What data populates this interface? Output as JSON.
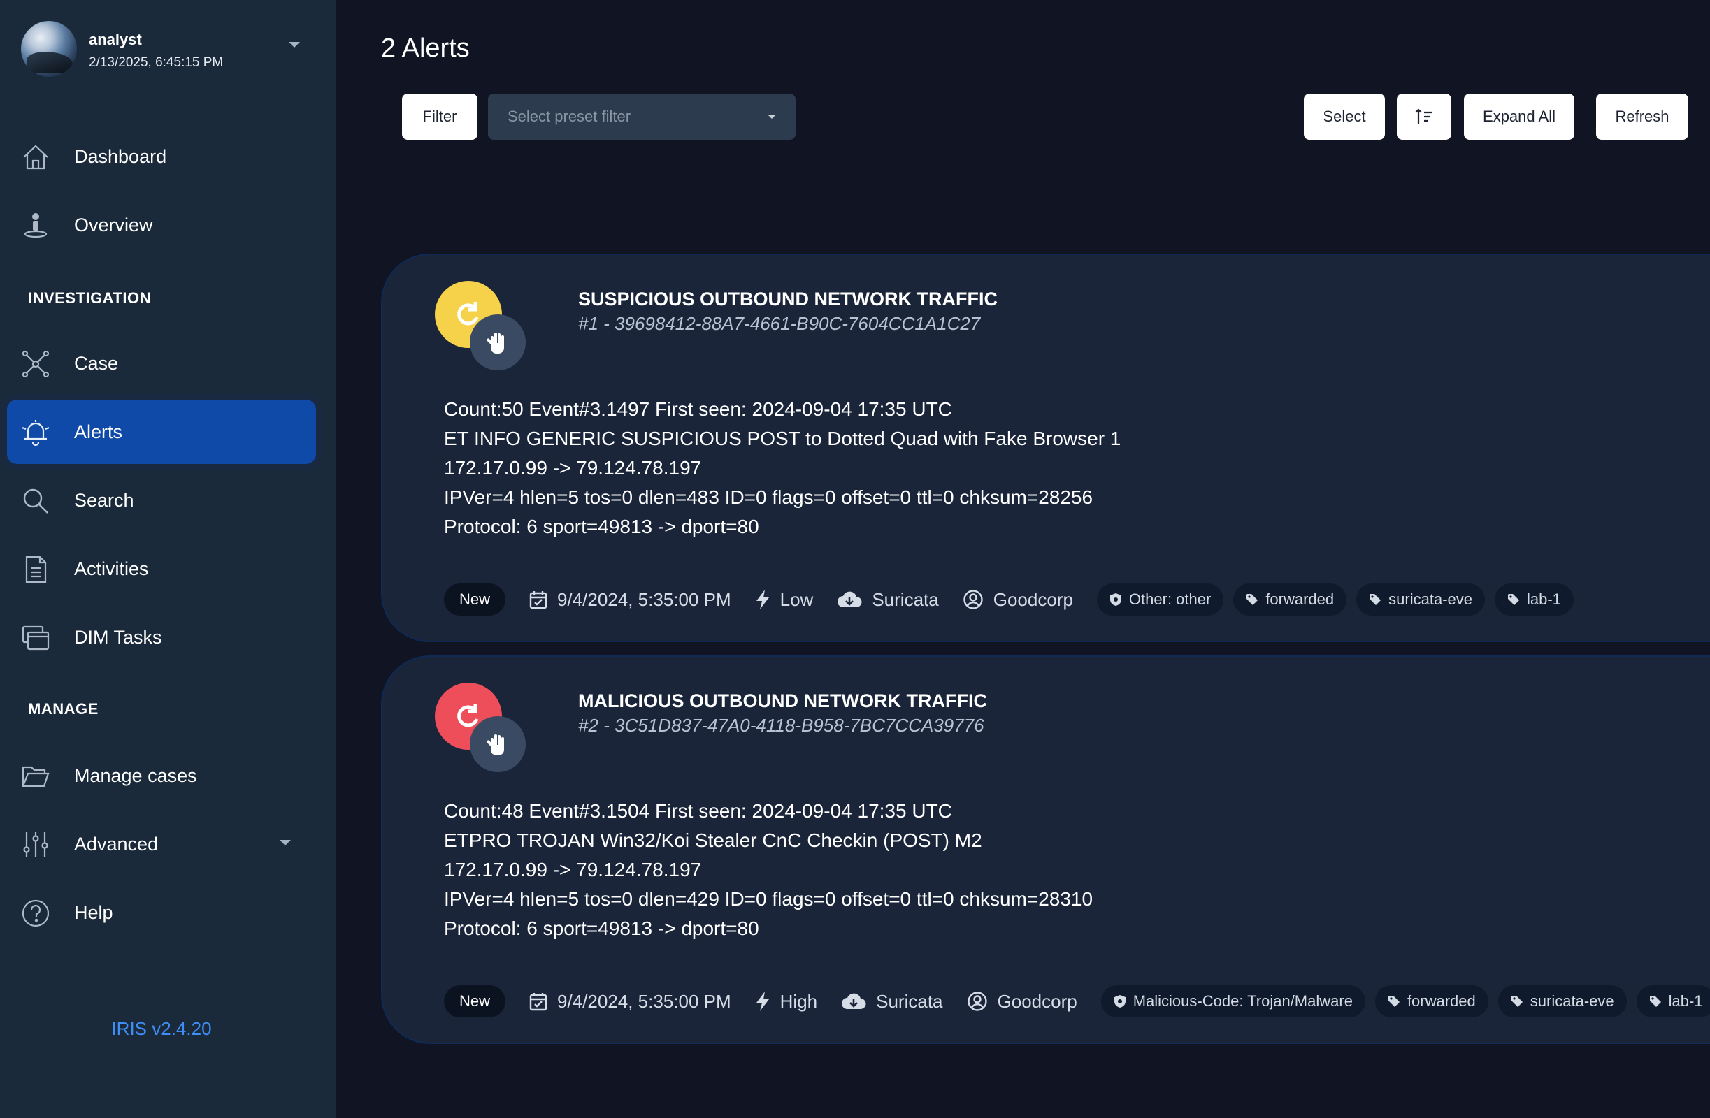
{
  "user": {
    "name": "analyst",
    "datetime": "2/13/2025, 6:45:15 PM"
  },
  "nav": {
    "dashboard": "Dashboard",
    "overview": "Overview",
    "section_investigation": "INVESTIGATION",
    "case": "Case",
    "alerts": "Alerts",
    "search": "Search",
    "activities": "Activities",
    "dim_tasks": "DIM Tasks",
    "section_manage": "MANAGE",
    "manage_cases": "Manage cases",
    "advanced": "Advanced",
    "help": "Help"
  },
  "version": "IRIS v2.4.20",
  "page": {
    "title": "2 Alerts"
  },
  "toolbar": {
    "filter_label": "Filter",
    "preset_placeholder": "Select preset filter",
    "select_label": "Select",
    "expand_all_label": "Expand All",
    "refresh_label": "Refresh"
  },
  "colors": {
    "sidebar_bg": "#1b2a3a",
    "main_bg": "#111422",
    "card_bg": "#1a253a",
    "active_nav": "#0f4aa8",
    "accent_link": "#3e8ef7",
    "severity_low": "#f5d24a",
    "severity_high": "#ee4d5a"
  },
  "alerts": [
    {
      "title": "SUSPICIOUS OUTBOUND NETWORK TRAFFIC",
      "uid": "#1 - 39698412-88A7-4661-B90C-7604CC1A1C27",
      "desc_lines": [
        "Count:50 Event#3.1497 First seen: 2024-09-04 17:35 UTC",
        "ET INFO GENERIC SUSPICIOUS POST to Dotted Quad with Fake Browser 1",
        "172.17.0.99 -> 79.124.78.197",
        "IPVer=4 hlen=5 tos=0 dlen=483 ID=0 flags=0 offset=0 ttl=0 chksum=28256",
        "Protocol: 6 sport=49813 -> dport=80"
      ],
      "status": "New",
      "date": "9/4/2024, 5:35:00 PM",
      "severity": "Low",
      "source": "Suricata",
      "customer": "Goodcorp",
      "tags": [
        "Other: other",
        "forwarded",
        "suricata-eve",
        "lab-1"
      ]
    },
    {
      "title": "MALICIOUS OUTBOUND NETWORK TRAFFIC",
      "uid": "#2 - 3C51D837-47A0-4118-B958-7BC7CCA39776",
      "desc_lines": [
        "Count:48 Event#3.1504 First seen: 2024-09-04 17:35 UTC",
        "ETPRO TROJAN Win32/Koi Stealer CnC Checkin (POST) M2",
        "172.17.0.99 -> 79.124.78.197",
        "IPVer=4 hlen=5 tos=0 dlen=429 ID=0 flags=0 offset=0 ttl=0 chksum=28310",
        "Protocol: 6 sport=49813 -> dport=80"
      ],
      "status": "New",
      "date": "9/4/2024, 5:35:00 PM",
      "severity": "High",
      "source": "Suricata",
      "customer": "Goodcorp",
      "tags": [
        "Malicious-Code: Trojan/Malware",
        "forwarded",
        "suricata-eve",
        "lab-1"
      ]
    }
  ]
}
